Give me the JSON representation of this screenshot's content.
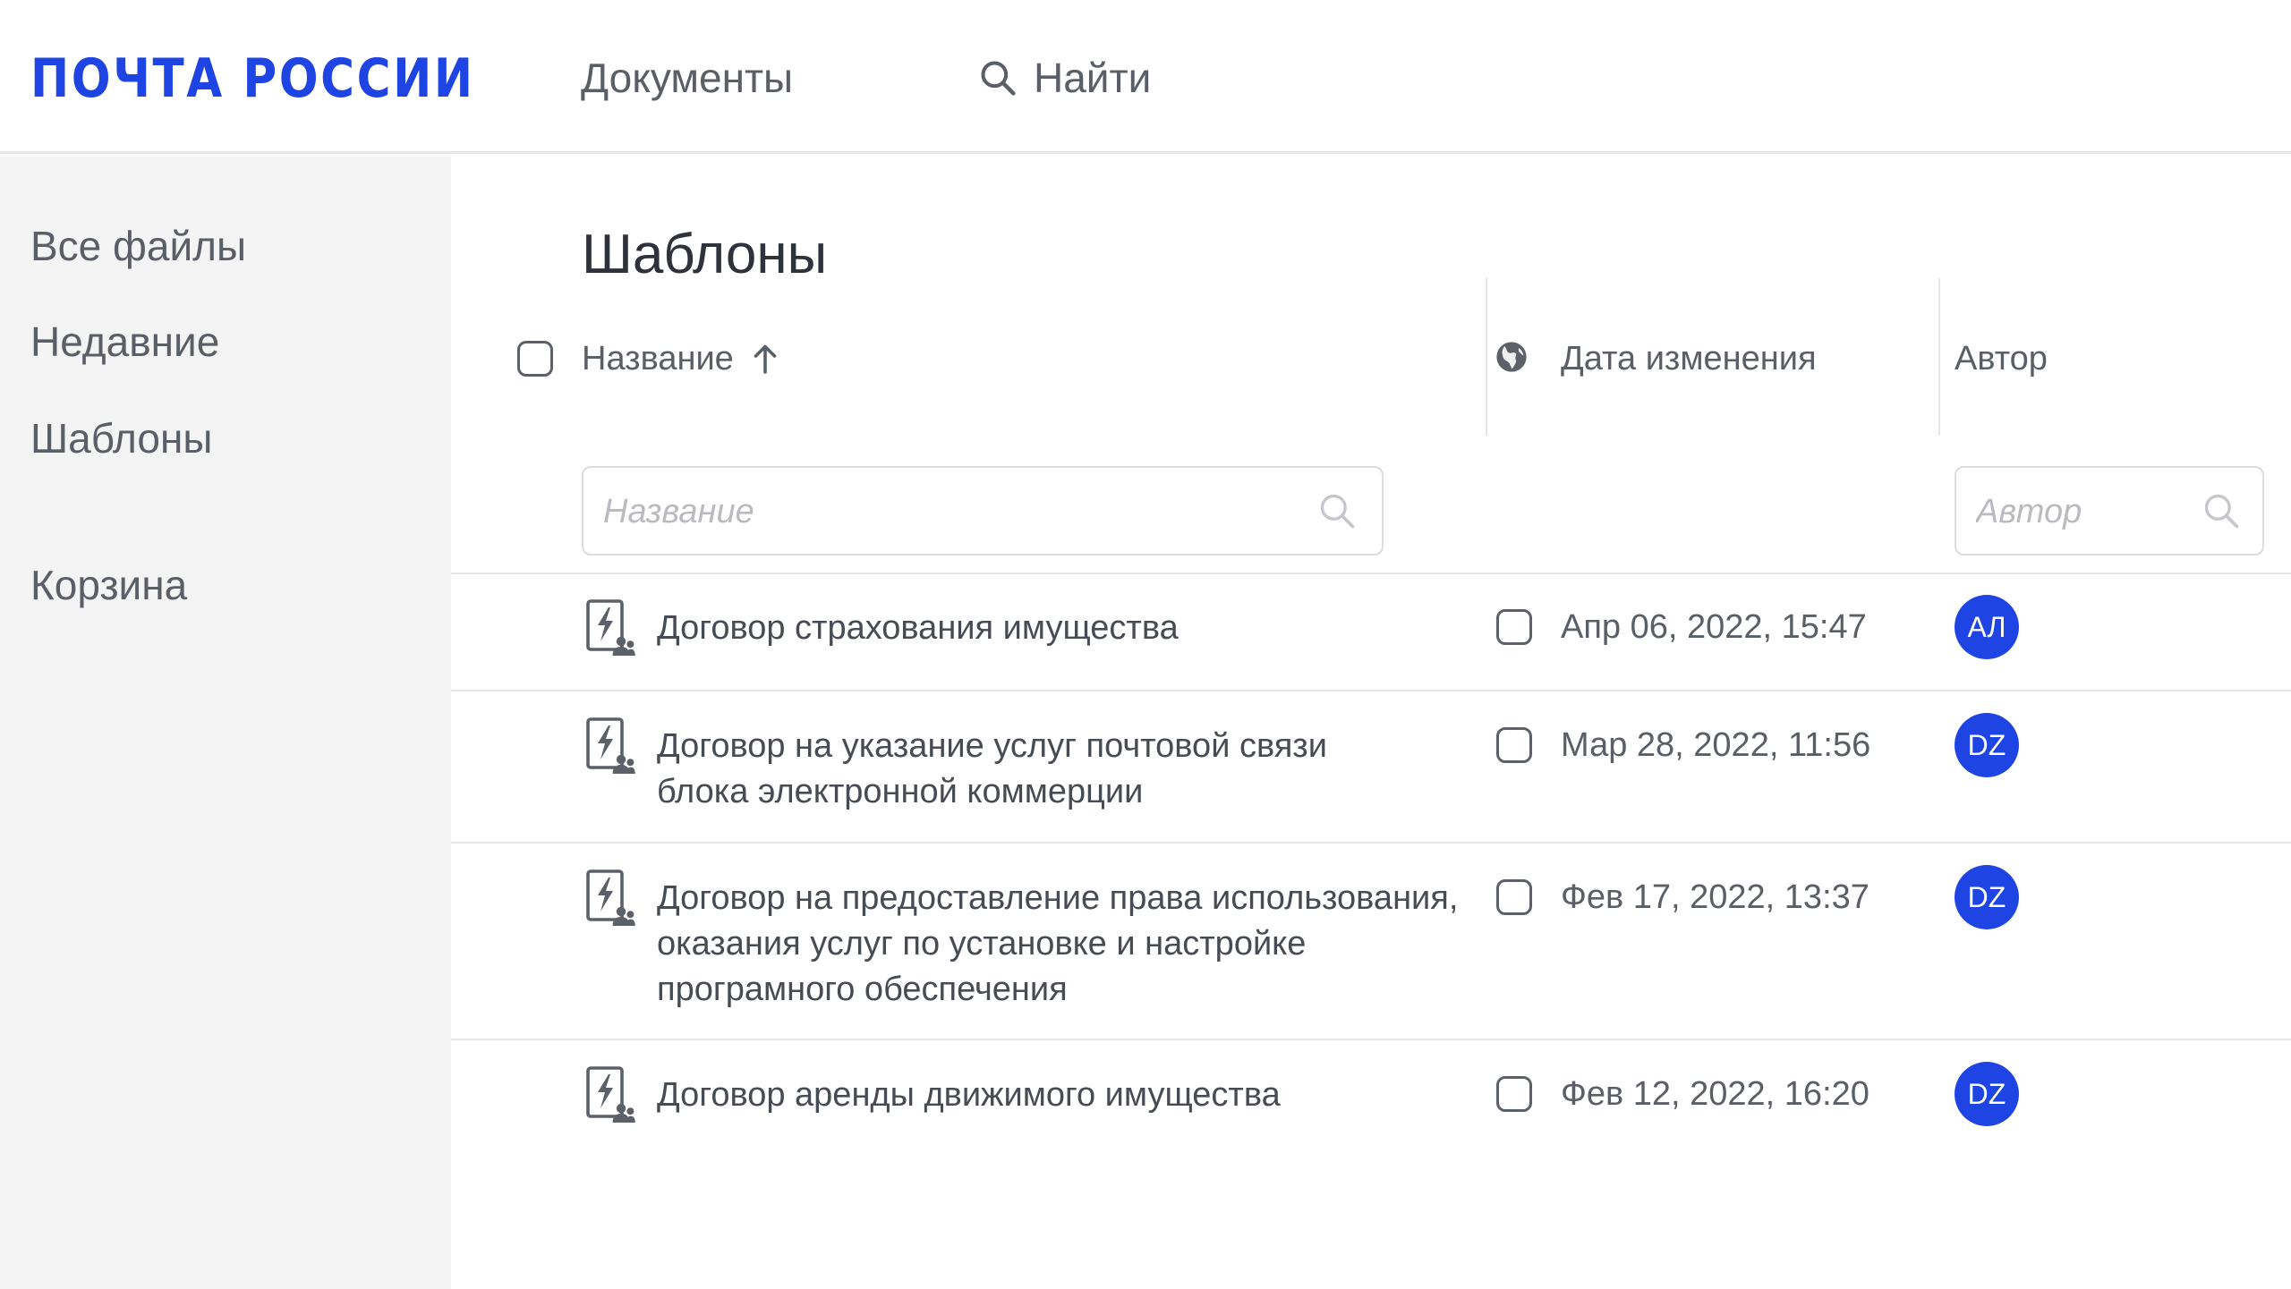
{
  "header": {
    "logo_text": "ПОЧТА РОССИИ",
    "nav_documents": "Документы",
    "nav_search": "Найти"
  },
  "sidebar": {
    "items": [
      {
        "label": "Все файлы"
      },
      {
        "label": "Недавние"
      },
      {
        "label": "Шаблоны"
      },
      {
        "label": "Корзина"
      }
    ]
  },
  "main": {
    "title": "Шаблоны",
    "columns": {
      "name": "Название",
      "date": "Дата изменения",
      "author": "Автор"
    },
    "filters": {
      "name_placeholder": "Название",
      "author_placeholder": "Автор"
    },
    "rows": [
      {
        "name_lines": [
          "Договор страхования имущества"
        ],
        "date": "Апр 06, 2022, 15:47",
        "author_initials": "АЛ"
      },
      {
        "name_lines": [
          "Договор на указание услуг почтовой связи",
          "блока электронной коммерции"
        ],
        "date": "Мар 28, 2022, 11:56",
        "author_initials": "DZ"
      },
      {
        "name_lines": [
          "Договор на предоставление права использования,",
          "оказания услуг по установке и настройке",
          "програмного обеспечения"
        ],
        "date": "Фев 17, 2022, 13:37",
        "author_initials": "DZ"
      },
      {
        "name_lines": [
          "Договор аренды движимого имущества"
        ],
        "date": "Фев 12, 2022, 16:20",
        "author_initials": "DZ"
      }
    ]
  },
  "colors": {
    "brand_blue": "#1e44e4",
    "sidebar_bg": "#f4f4f5",
    "text": "#474b54",
    "divider": "#e6e7ea"
  },
  "icons": {
    "search": "search-icon",
    "sort": "arrow-up-icon",
    "globe": "globe-icon",
    "document": "template-document-icon"
  }
}
